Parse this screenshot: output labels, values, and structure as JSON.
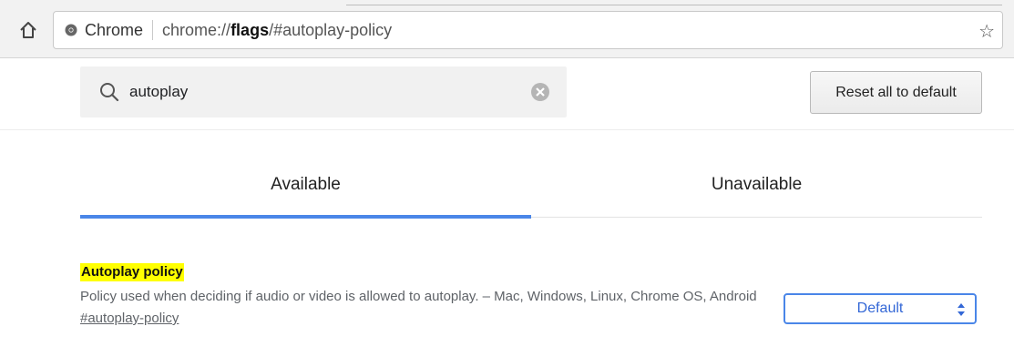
{
  "browser": {
    "origin_label": "Chrome",
    "url_prefix": "chrome://",
    "url_host": "flags",
    "url_path": "/#autoplay-policy"
  },
  "search": {
    "value": "autoplay",
    "placeholder": "Search flags"
  },
  "reset_button_label": "Reset all to default",
  "tabs": [
    {
      "label": "Available",
      "selected": true
    },
    {
      "label": "Unavailable",
      "selected": false
    }
  ],
  "flag": {
    "title": "Autoplay policy",
    "description": "Policy used when deciding if audio or video is allowed to autoplay. – Mac, Windows, Linux, Chrome OS, Android",
    "link": "#autoplay-policy",
    "selected_option": "Default"
  },
  "colors": {
    "accent": "#4a86e8",
    "highlight": "#ffff00"
  },
  "icons": [
    "home-icon",
    "chrome-icon",
    "star-icon",
    "search-icon",
    "clear-icon",
    "select-arrows-icon"
  ]
}
